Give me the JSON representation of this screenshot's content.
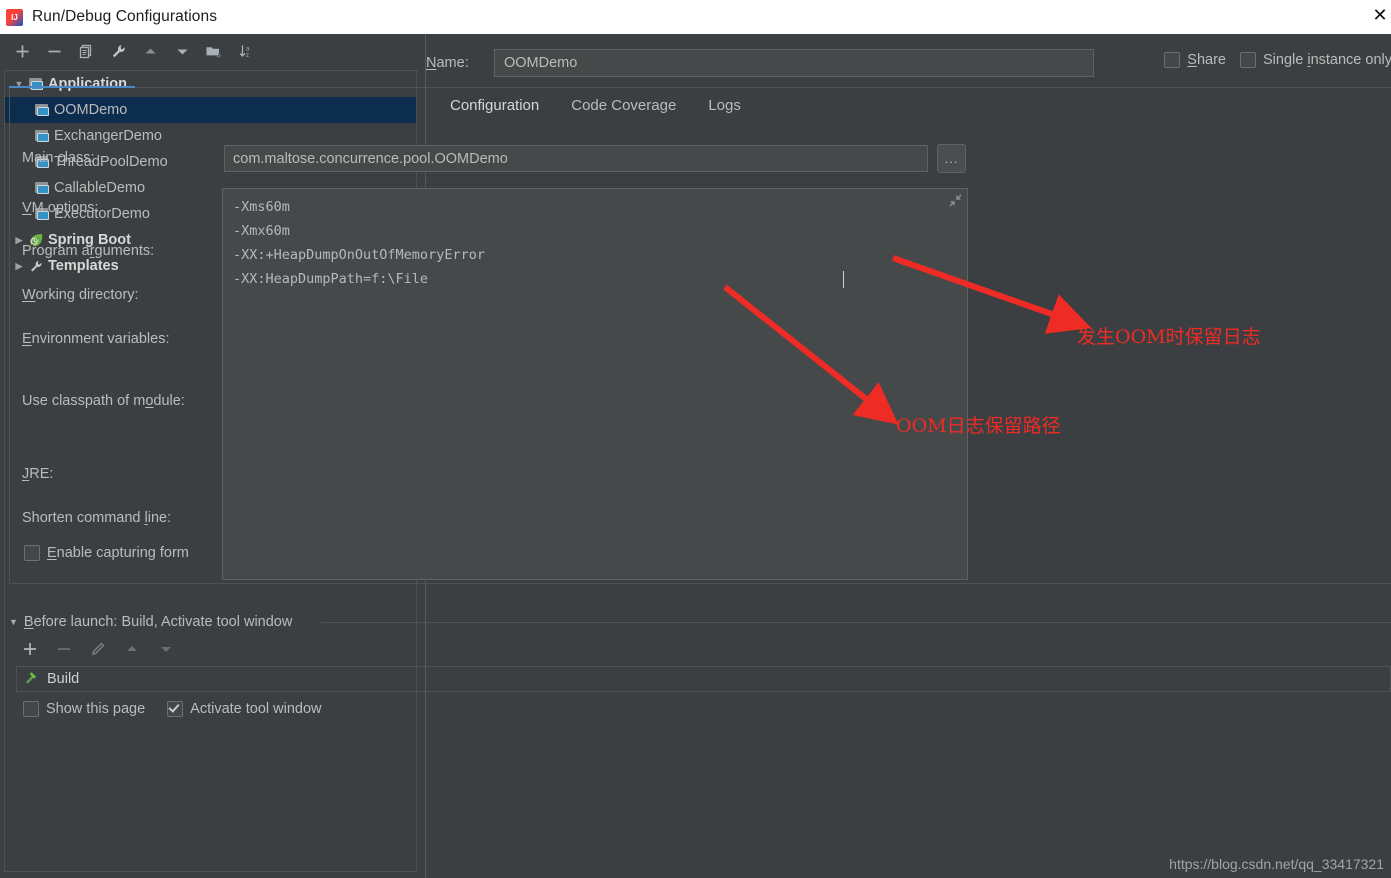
{
  "window": {
    "title": "Run/Debug Configurations",
    "logo_icon": "intellij-idea-logo",
    "close_icon": "close-icon",
    "close_glyph": "✕"
  },
  "left_panel": {
    "toolbar": [
      {
        "name": "add-configuration-button",
        "icon": "plus-icon"
      },
      {
        "name": "remove-configuration-button",
        "icon": "minus-icon"
      },
      {
        "name": "copy-configuration-button",
        "icon": "copy-icon"
      },
      {
        "name": "edit-templates-button",
        "icon": "wrench-icon"
      },
      {
        "name": "move-up-button",
        "icon": "arrow-up-icon"
      },
      {
        "name": "move-down-button",
        "icon": "arrow-down-icon"
      },
      {
        "name": "new-folder-button",
        "icon": "folder-add-icon"
      },
      {
        "name": "sort-configurations-button",
        "icon": "sort-az-icon"
      }
    ],
    "tree": [
      {
        "label": "Application",
        "icon": "application-icon",
        "level": 0,
        "expanded": true,
        "group": true,
        "selected": false
      },
      {
        "label": "OOMDemo",
        "icon": "application-icon",
        "level": 1,
        "group": false,
        "selected": true
      },
      {
        "label": "ExchangerDemo",
        "icon": "application-icon",
        "level": 1,
        "group": false,
        "selected": false
      },
      {
        "label": "ThreadPoolDemo",
        "icon": "application-icon",
        "level": 1,
        "group": false,
        "selected": false
      },
      {
        "label": "CallableDemo",
        "icon": "application-icon",
        "level": 1,
        "group": false,
        "selected": false
      },
      {
        "label": "ExecutorDemo",
        "icon": "application-icon",
        "level": 1,
        "group": false,
        "selected": false
      },
      {
        "label": "Spring Boot",
        "icon": "spring-boot-icon",
        "level": 0,
        "expanded": false,
        "group": true,
        "selected": false
      },
      {
        "label": "Templates",
        "icon": "wrench-icon",
        "level": 0,
        "expanded": false,
        "group": true,
        "selected": false
      }
    ]
  },
  "right_panel": {
    "name_label": "Name:",
    "name_value": "OOMDemo",
    "share_label": "Share",
    "share_checked": false,
    "single_instance_label": "Single instance only",
    "single_instance_checked": false,
    "tabs": [
      {
        "label": "Configuration",
        "active": true
      },
      {
        "label": "Code Coverage",
        "active": false
      },
      {
        "label": "Logs",
        "active": false
      }
    ],
    "fields": {
      "main_class_label": "Main class:",
      "main_class_value": "com.maltose.concurrence.pool.OOMDemo",
      "browse_button_label": "...",
      "vm_options_label": "VM options:",
      "vm_options_value": "-Xms60m\n-Xmx60m\n-XX:+HeapDumpOnOutOfMemoryError\n-XX:HeapDumpPath=f:\\File",
      "vm_expand_icon": "expand-icon",
      "program_arguments_label": "Program arguments:",
      "working_directory_label": "Working directory:",
      "environment_variables_label": "Environment variables:",
      "use_classpath_label": "Use classpath of module:",
      "jre_label": "JRE:",
      "shorten_command_line_label": "Shorten command line:",
      "enable_capturing_label": "Enable capturing form",
      "enable_capturing_checked": false
    },
    "before_launch": {
      "header": "Before launch: Build, Activate tool window",
      "toolbar": [
        {
          "name": "add-task-button",
          "icon": "plus-icon",
          "enabled": true
        },
        {
          "name": "remove-task-button",
          "icon": "minus-icon",
          "enabled": false
        },
        {
          "name": "edit-task-button",
          "icon": "pencil-icon",
          "enabled": false
        },
        {
          "name": "move-task-up-button",
          "icon": "arrow-up-icon",
          "enabled": false
        },
        {
          "name": "move-task-down-button",
          "icon": "arrow-down-icon",
          "enabled": false
        }
      ],
      "tasks": [
        {
          "label": "Build",
          "icon": "build-hammer-icon"
        }
      ],
      "show_page_label": "Show this page",
      "show_page_checked": false,
      "activate_tool_window_label": "Activate tool window",
      "activate_tool_window_checked": true
    }
  },
  "annotations": [
    {
      "name": "annotation-oom-log",
      "text": "发生OOM时保留日志",
      "color": "#ee2b24"
    },
    {
      "name": "annotation-oom-path",
      "text": "OOM日志保留路径",
      "color": "#ee2b24"
    }
  ],
  "watermark": "https://blog.csdn.net/qq_33417321",
  "colors": {
    "background": "#3c3f41",
    "selection": "#0d2d4f",
    "accent": "#4a88c7",
    "annotation": "#ee2b24",
    "field_background": "#45494a"
  }
}
